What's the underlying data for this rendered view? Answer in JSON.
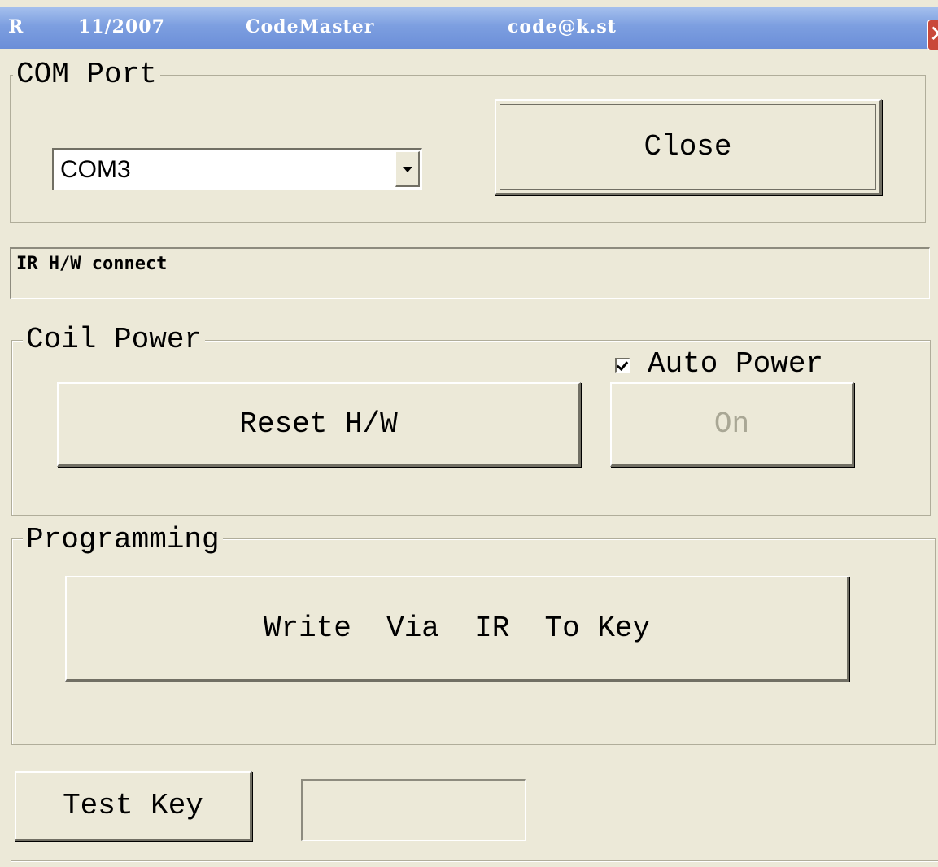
{
  "titlebar": {
    "frag_a": "R",
    "date": "11/2007",
    "app_name": "CodeMaster",
    "email": "code@k.st"
  },
  "com_port": {
    "group_title": "COM Port",
    "selected_port": "COM3",
    "close_label": "Close"
  },
  "status": {
    "text": "IR H/W connect"
  },
  "coil_power": {
    "group_title": "Coil Power",
    "auto_power_label": "Auto Power",
    "auto_power_checked": true,
    "reset_label": "Reset H/W",
    "on_label": "On"
  },
  "programming": {
    "group_title": "Programming",
    "write_label": "Write  Via  IR  To Key"
  },
  "test": {
    "test_key_label": "Test Key",
    "key_value": ""
  },
  "colors": {
    "window_bg": "#ece9d8",
    "titlebar": "#7d9fe0",
    "disabled_text": "#a9a795"
  },
  "icons": {
    "close": "close-icon",
    "dropdown": "chevron-down-icon",
    "check": "checkmark-icon"
  }
}
